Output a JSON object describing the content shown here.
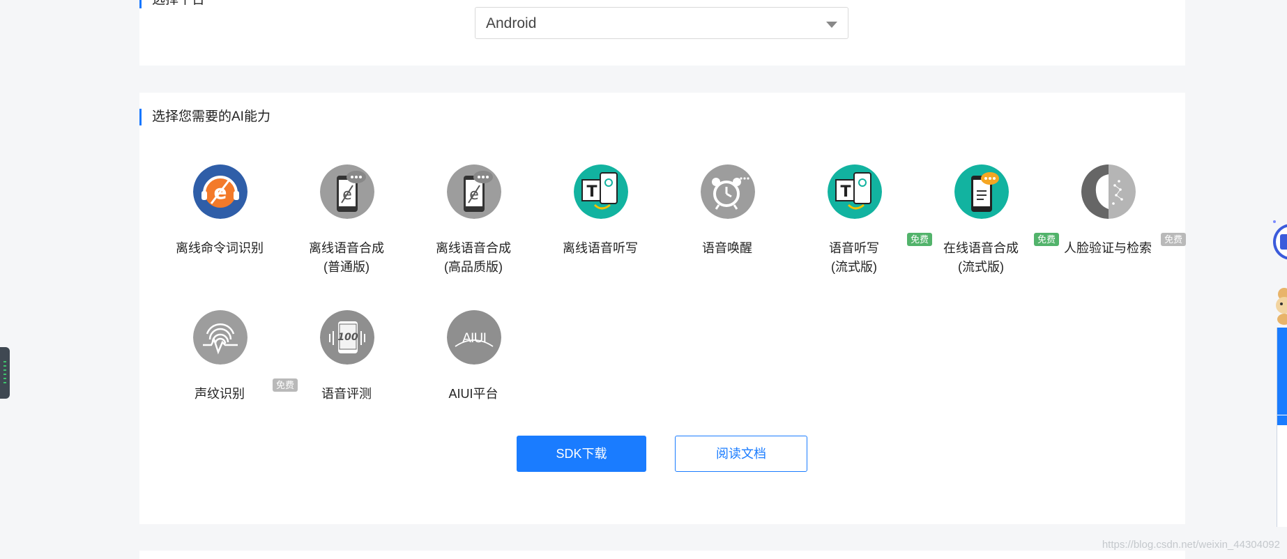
{
  "platform_section": {
    "title": "选择平台",
    "select": {
      "value": "Android"
    }
  },
  "ai_section": {
    "title": "选择您需要的AI能力",
    "items": [
      {
        "label_line1": "离线命令词识别",
        "label_line2": "",
        "icon": "offline-command-icon",
        "badge": ""
      },
      {
        "label_line1": "离线语音合成",
        "label_line2": "(普通版)",
        "icon": "tts-standard-icon",
        "badge": ""
      },
      {
        "label_line1": "离线语音合成",
        "label_line2": "(高品质版)",
        "icon": "tts-hq-icon",
        "badge": ""
      },
      {
        "label_line1": "离线语音听写",
        "label_line2": "",
        "icon": "offline-dictation-icon",
        "badge": ""
      },
      {
        "label_line1": "语音唤醒",
        "label_line2": "",
        "icon": "alarm-clock-icon",
        "badge": ""
      },
      {
        "label_line1": "语音听写",
        "label_line2": "(流式版)",
        "icon": "streaming-dictation-icon",
        "badge": "免费"
      },
      {
        "label_line1": "在线语音合成",
        "label_line2": "(流式版)",
        "icon": "online-tts-icon",
        "badge": "免费"
      },
      {
        "label_line1": "人脸验证与检索",
        "label_line2": "",
        "icon": "face-icon",
        "badge": "免费"
      },
      {
        "label_line1": "声纹识别",
        "label_line2": "",
        "icon": "fingerprint-icon",
        "badge": "免费"
      },
      {
        "label_line1": "语音评测",
        "label_line2": "",
        "icon": "speech-eval-icon",
        "badge": ""
      },
      {
        "label_line1": "AIUI平台",
        "label_line2": "",
        "icon": "aiui-icon",
        "badge": ""
      }
    ],
    "buttons": {
      "sdk": "SDK下载",
      "docs": "阅读文档"
    }
  },
  "watermark": "https://blog.csdn.net/weixin_44304092",
  "colors": {
    "accent": "#1a7cff",
    "badge_green": "#52b36b",
    "badge_gray": "#b9b9b9",
    "teal": "#12b3a0",
    "gray_icon": "#9a9a9a"
  }
}
